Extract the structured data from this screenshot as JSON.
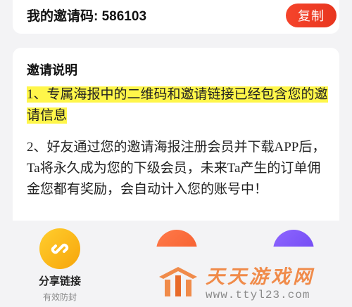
{
  "invite": {
    "label": "我的邀请码: 586103",
    "copy_label": "复制"
  },
  "instructions": {
    "title": "邀请说明",
    "item1": "1、专属海报中的二维码和邀请链接已经包含您的邀请信息",
    "item2": "2、好友通过您的邀请海报注册会员并下载APP后，Ta将永久成为您的下级会员，未来Ta产生的订单佣金您都有奖励，会自动计入您的账号中！"
  },
  "share": {
    "link_label": "分享链接",
    "link_sub": "有效防封",
    "link_icon": "link-icon"
  },
  "watermark": {
    "title": "天天游戏网",
    "url": "www.ttyl23.com"
  },
  "colors": {
    "accent": "#f5442b",
    "highlight": "#fff64a",
    "link_circle": "#f7a50a",
    "watermark": "#f08b4a"
  }
}
